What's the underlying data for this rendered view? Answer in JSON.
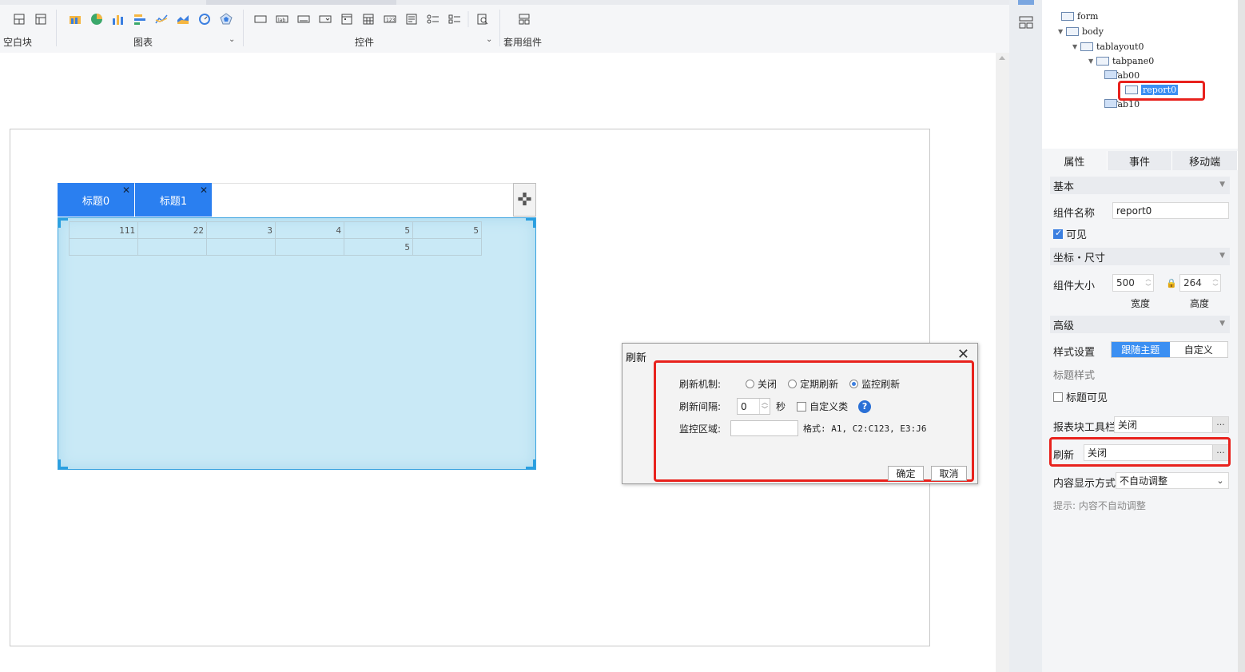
{
  "toolbar": {
    "group_blank_label": "空白块",
    "group_chart_label": "图表",
    "group_widget_label": "控件",
    "group_template_label": "套用组件"
  },
  "canvas": {
    "tabs": [
      {
        "label": "标题0"
      },
      {
        "label": "标题1"
      }
    ],
    "report_rows": [
      [
        "111",
        "22",
        "3",
        "4",
        "5",
        "5"
      ],
      [
        "",
        "",
        "",
        "",
        "5",
        ""
      ]
    ]
  },
  "dialog": {
    "title": "刷新",
    "mechanism_label": "刷新机制:",
    "options": [
      "关闭",
      "定期刷新",
      "监控刷新"
    ],
    "selected": "监控刷新",
    "interval_label": "刷新间隔:",
    "interval_value": "0",
    "interval_unit": "秒",
    "custom_class_label": "自定义类",
    "monitor_area_label": "监控区域:",
    "monitor_area_value": "",
    "format_hint": "格式: A1, C2:C123, E3:J6",
    "ok_label": "确定",
    "cancel_label": "取消"
  },
  "tree": {
    "nodes": [
      {
        "label": "form"
      },
      {
        "label": "body"
      },
      {
        "label": "tablayout0"
      },
      {
        "label": "tabpane0"
      },
      {
        "label": "Tab00"
      },
      {
        "label": "report0"
      },
      {
        "label": "Tab10"
      }
    ]
  },
  "panel": {
    "tabs": [
      "属性",
      "事件",
      "移动端"
    ],
    "section_basic": "基本",
    "name_label": "组件名称",
    "name_value": "report0",
    "visible_label": "可见",
    "section_pos": "坐标・尺寸",
    "size_label": "组件大小",
    "width_value": "500",
    "height_value": "264",
    "width_label": "宽度",
    "height_label": "高度",
    "section_advanced": "高级",
    "style_label": "样式设置",
    "style_options": [
      "跟随主题",
      "自定义"
    ],
    "title_style_label": "标题样式",
    "title_visible_label": "标题可见",
    "toolbar_label": "报表块工具栏",
    "toolbar_value": "关闭",
    "refresh_label": "刷新",
    "refresh_value": "关闭",
    "display_label": "内容显示方式",
    "display_value": "不自动调整",
    "hint": "提示: 内容不自动调整"
  },
  "colors": {
    "accent": "#2a7ff0",
    "highlight_red": "#e8221d",
    "report_bg": "#c9e9f6"
  }
}
